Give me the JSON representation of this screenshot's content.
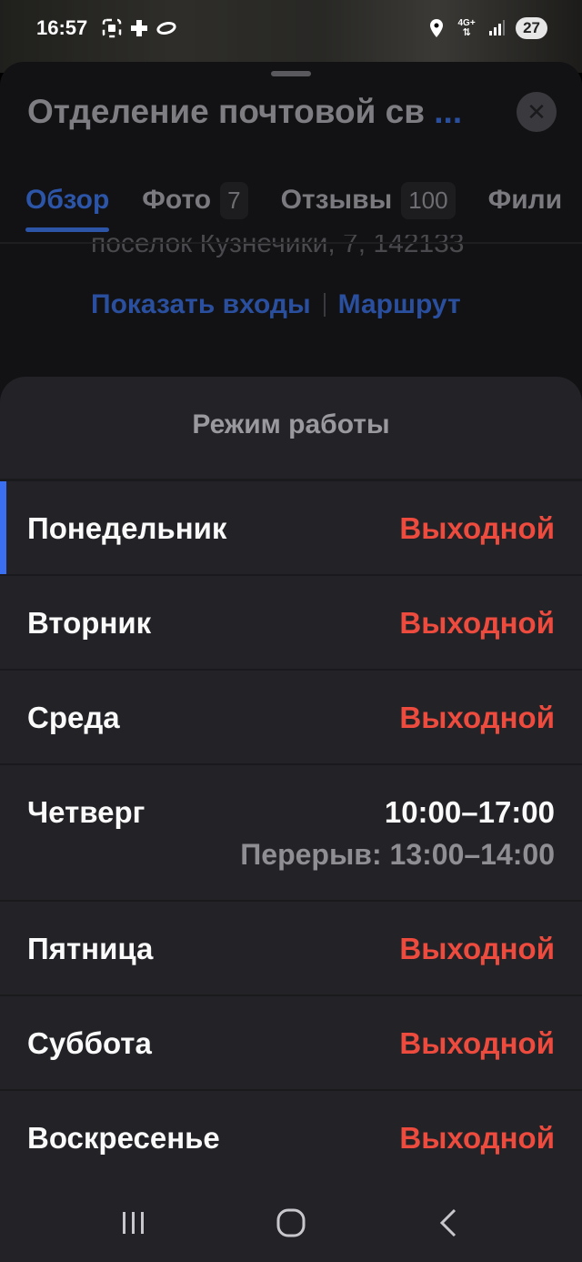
{
  "status_bar": {
    "time": "16:57",
    "network": "4G+",
    "battery": "27",
    "icons": [
      "screenshot-icon",
      "plus-badge-icon",
      "ring-icon",
      "location-icon",
      "data-arrows-icon",
      "signal-icon"
    ]
  },
  "card": {
    "title": "Отделение почтовой св",
    "title_more": "...",
    "close_icon": "close-icon",
    "tabs": [
      {
        "label": "Обзор",
        "badge": "",
        "active": true
      },
      {
        "label": "Фото",
        "badge": "7",
        "active": false
      },
      {
        "label": "Отзывы",
        "badge": "100",
        "active": false
      },
      {
        "label": "Фили",
        "badge": "",
        "active": false
      }
    ],
    "address": "поселок Кузнечики, 7, 142133",
    "links": {
      "entrances": "Показать входы",
      "route": "Маршрут"
    }
  },
  "hours": {
    "title": "Режим работы",
    "days": [
      {
        "day": "Понедельник",
        "status": "Выходной",
        "break": "",
        "current": true
      },
      {
        "day": "Вторник",
        "status": "Выходной",
        "break": "",
        "current": false
      },
      {
        "day": "Среда",
        "status": "Выходной",
        "break": "",
        "current": false
      },
      {
        "day": "Четверг",
        "status": "10:00–17:00",
        "break": "Перерыв: 13:00–14:00",
        "current": false
      },
      {
        "day": "Пятница",
        "status": "Выходной",
        "break": "",
        "current": false
      },
      {
        "day": "Суббота",
        "status": "Выходной",
        "break": "",
        "current": false
      },
      {
        "day": "Воскресенье",
        "status": "Выходной",
        "break": "",
        "current": false
      }
    ]
  },
  "nav": {
    "recent": "recent-apps-icon",
    "home": "home-icon",
    "back": "back-icon"
  },
  "colors": {
    "accent_blue": "#2c55a8",
    "closed_red": "#ee4b3f",
    "current_marker": "#3a6ff2"
  }
}
